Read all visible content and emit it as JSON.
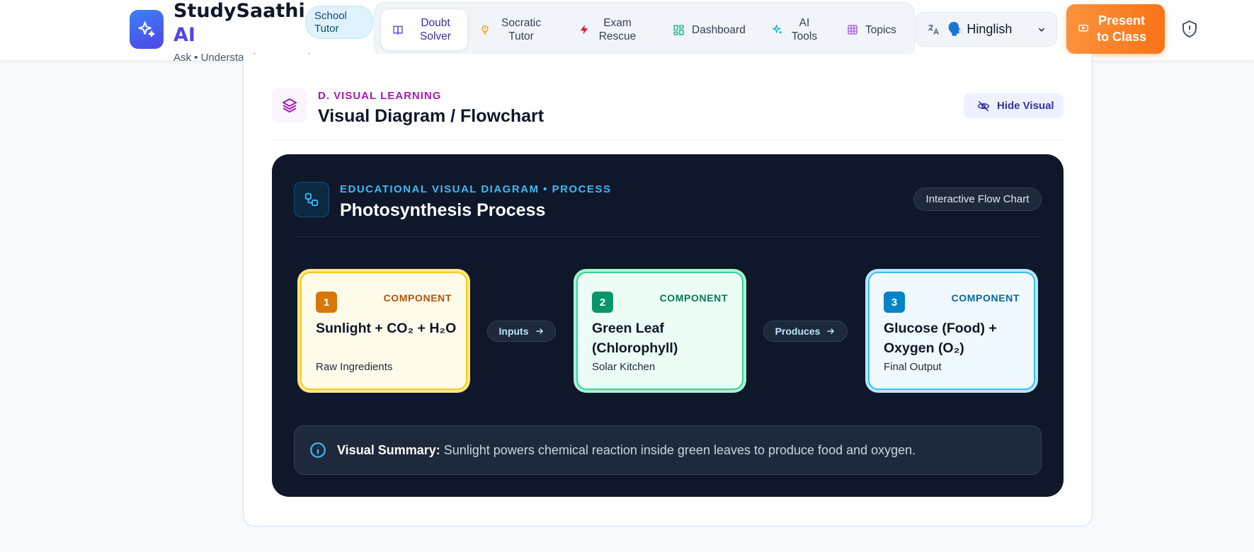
{
  "header": {
    "brand_name": "StudySaathi",
    "brand_suffix": "AI",
    "tagline": "Ask • Understand • See • Quiz",
    "badge": "School Tutor",
    "nav": [
      {
        "label": "Doubt Solver",
        "icon": "book-icon",
        "active": true
      },
      {
        "label": "Socratic Tutor",
        "icon": "lightbulb-icon",
        "active": false
      },
      {
        "label": "Exam Rescue",
        "icon": "lightning-icon",
        "active": false
      },
      {
        "label": "Dashboard",
        "icon": "grid-icon",
        "active": false
      },
      {
        "label": "AI Tools",
        "icon": "sparkle-icon",
        "active": false
      },
      {
        "label": "Topics",
        "icon": "table-icon",
        "active": false
      }
    ],
    "language": {
      "icon": "translate-icon",
      "value": "🗣️ Hinglish"
    },
    "present_button": "Present to Class",
    "shield_icon": "shield-icon"
  },
  "section": {
    "eyebrow": "D. VISUAL LEARNING",
    "title": "Visual Diagram / Flowchart",
    "hide_button": "Hide Visual"
  },
  "diagram": {
    "eyebrow": "EDUCATIONAL VISUAL DIAGRAM • PROCESS",
    "title": "Photosynthesis Process",
    "chip": "Interactive Flow Chart",
    "nodes": [
      {
        "number": "1",
        "tag": "COMPONENT",
        "name": "Sunlight + CO₂ + H₂O",
        "subtitle": "Raw Ingredients",
        "accent": "#d97706"
      },
      {
        "number": "2",
        "tag": "COMPONENT",
        "name": "Green Leaf (Chlorophyll)",
        "subtitle": "Solar Kitchen",
        "accent": "#059669"
      },
      {
        "number": "3",
        "tag": "COMPONENT",
        "name": "Glucose (Food) + Oxygen (O₂)",
        "subtitle": "Final Output",
        "accent": "#0284c7"
      }
    ],
    "connectors": [
      {
        "label": "Inputs"
      },
      {
        "label": "Produces"
      }
    ],
    "summary_label": "Visual Summary:",
    "summary_text": "Sunlight powers chemical reaction inside green leaves to produce food and oxygen."
  },
  "colors": {
    "brand": "#4f46e5",
    "accent_orange": "#f97316",
    "panel_bg": "#0f172a",
    "sky": "#38bdf8"
  }
}
